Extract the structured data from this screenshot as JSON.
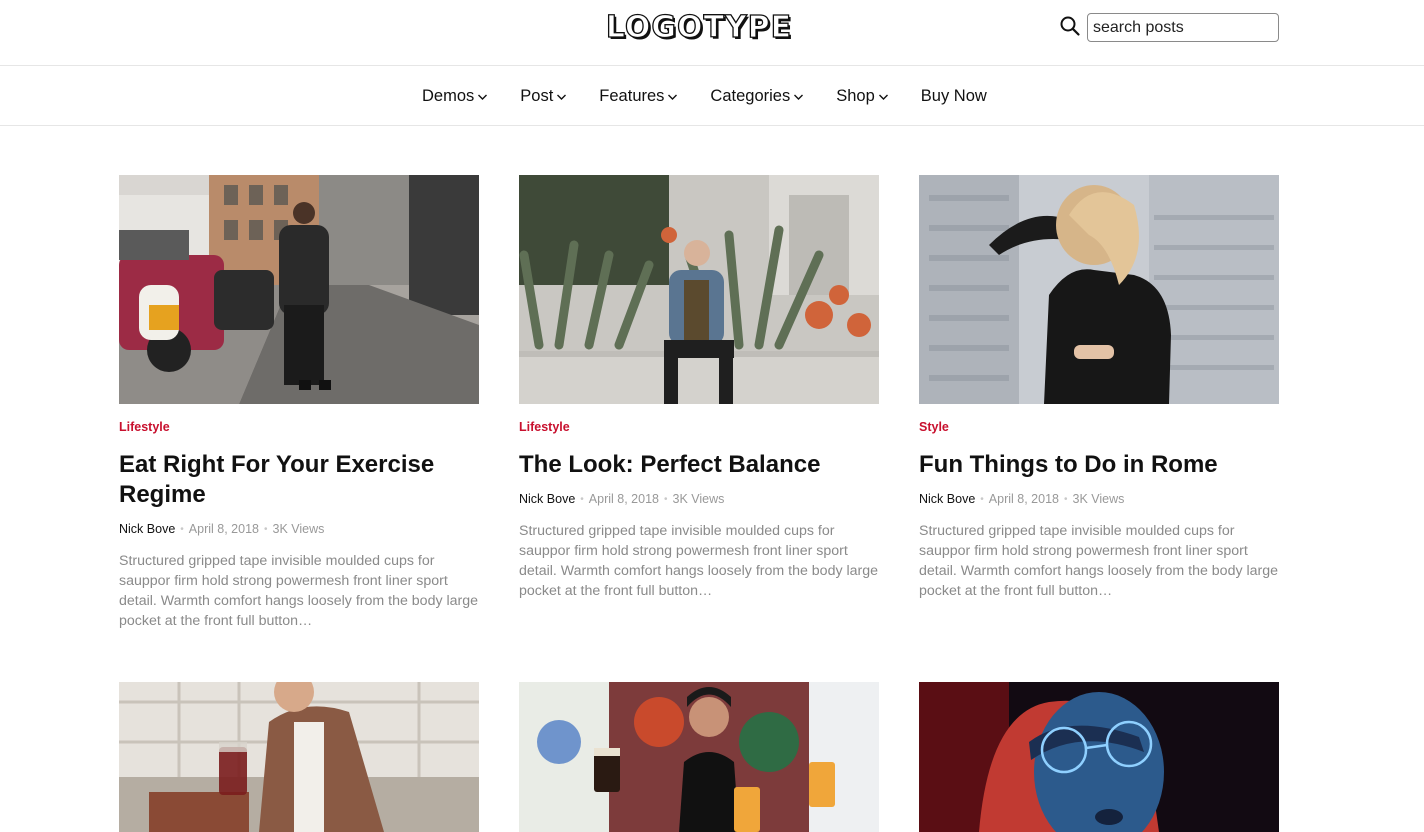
{
  "header": {
    "logo": "LOGOTYPE",
    "search_placeholder": "search posts",
    "search_value": ""
  },
  "nav": {
    "items": [
      {
        "label": "Demos",
        "has_dropdown": true
      },
      {
        "label": "Post",
        "has_dropdown": true
      },
      {
        "label": "Features",
        "has_dropdown": true
      },
      {
        "label": "Categories",
        "has_dropdown": true
      },
      {
        "label": "Shop",
        "has_dropdown": true
      },
      {
        "label": "Buy Now",
        "has_dropdown": false
      }
    ]
  },
  "colors": {
    "accent": "#c8102e",
    "text": "#111111",
    "muted": "#8a8a8a",
    "border": "#e6e6e6"
  },
  "posts": [
    {
      "category": "Lifestyle",
      "title": "Eat Right For Your Exercise Regime",
      "author": "Nick Bove",
      "date": "April 8, 2018",
      "views": "3K Views",
      "excerpt": "Structured gripped tape invisible moulded cups for sauppor firm hold strong powermesh front liner sport detail. Warmth comfort hangs loosely from the body large pocket at the front full button…",
      "image": "street-man-leather-jacket-photo"
    },
    {
      "category": "Lifestyle",
      "title": "The Look: Perfect Balance",
      "author": "Nick Bove",
      "date": "April 8, 2018",
      "views": "3K Views",
      "excerpt": "Structured gripped tape invisible moulded cups for sauppor firm hold strong powermesh front liner sport detail. Warmth comfort hangs loosely from the body large pocket at the front full button…",
      "image": "man-sitting-by-plants-photo"
    },
    {
      "category": "Style",
      "title": "Fun Things to Do in Rome",
      "author": "Nick Bove",
      "date": "April 8, 2018",
      "views": "3K Views",
      "excerpt": "Structured gripped tape invisible moulded cups for sauppor firm hold strong powermesh front liner sport detail. Warmth comfort hangs loosely from the body large pocket at the front full button…",
      "image": "woman-blonde-hair-city-photo"
    },
    {
      "image": "man-holding-drink-photo"
    },
    {
      "image": "friends-with-beers-photo"
    },
    {
      "image": "woman-glasses-neon-photo"
    }
  ]
}
